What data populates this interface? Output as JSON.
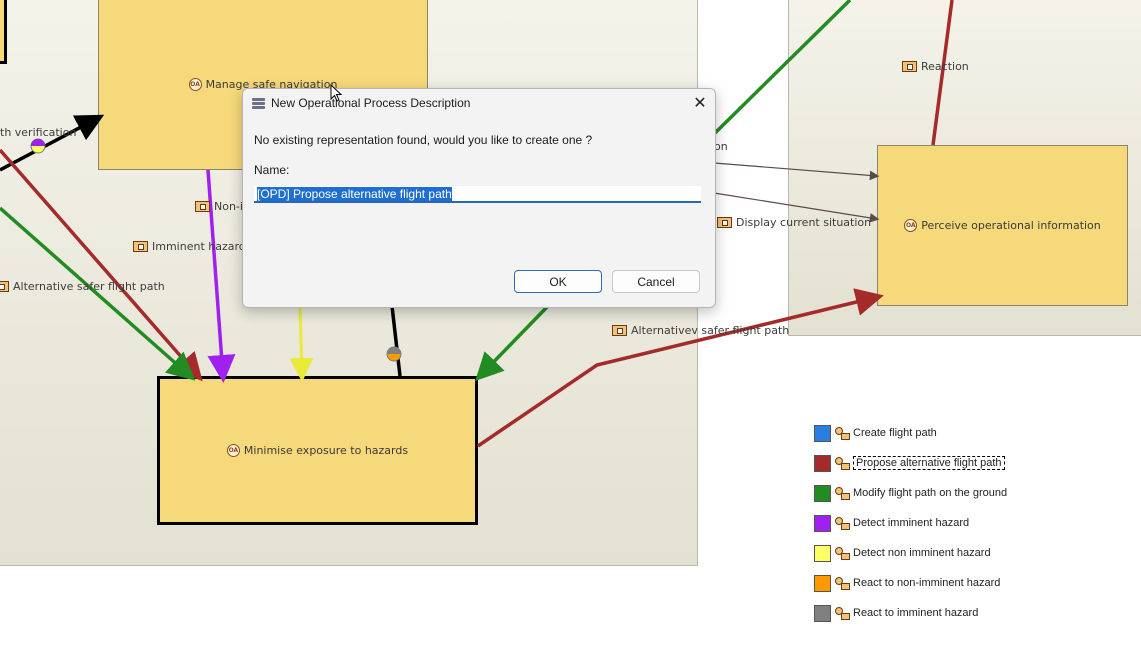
{
  "diagram": {
    "boxes": {
      "manage_safe_navigation": "Manage safe navigation",
      "minimise_exposure": "Minimise exposure to hazards",
      "perceive_operational_info": "Perceive operational information"
    },
    "exchanges": {
      "path_verification": "th verification",
      "non_imminent": "Non-i",
      "imminent_hazard": "Imminent hazard d",
      "alternative_safer_left": "Alternative safer flight path",
      "reaction": "Reaction",
      "on_partial": "on",
      "display_current": "Display current situation",
      "alternative_safer_right": "Alternativev safer flight path"
    }
  },
  "dialog": {
    "title": "New Operational Process Description",
    "close_glyph": "✕",
    "message": "No existing representation found, would you like to create one ?",
    "name_label": "Name:",
    "name_value": "[OPD] Propose alternative flight path",
    "ok_label": "OK",
    "cancel_label": "Cancel"
  },
  "legend": {
    "items": [
      {
        "label": "Create flight path",
        "color": "#2a7de1"
      },
      {
        "label": "Propose alternative flight path",
        "color": "#a52a2a"
      },
      {
        "label": "Modify flight path on the ground",
        "color": "#228b22"
      },
      {
        "label": "Detect imminent hazard",
        "color": "#a020f0"
      },
      {
        "label": "Detect non imminent hazard",
        "color": "#ffff66"
      },
      {
        "label": "React to non-imminent hazard",
        "color": "#ff9900"
      },
      {
        "label": "React to imminent hazard",
        "color": "#808080"
      }
    ]
  },
  "colors": {
    "box_fill": "#f6d97a",
    "panel_background": "#ebe9dc",
    "selection_blue": "#1f6fd0"
  }
}
